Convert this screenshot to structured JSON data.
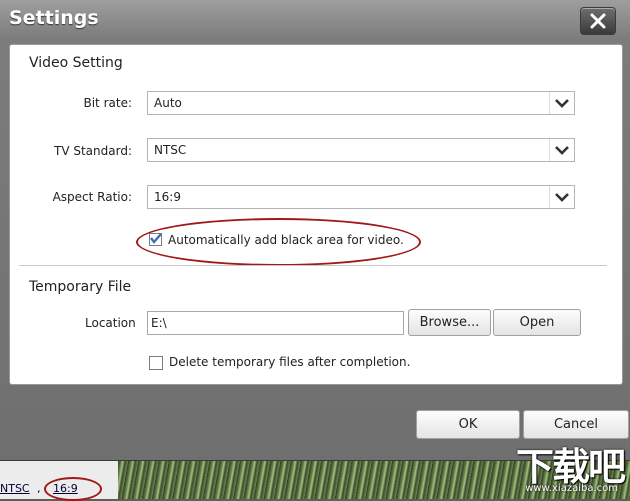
{
  "window": {
    "title": "Settings",
    "close_icon": "close-icon"
  },
  "video": {
    "section_title": "Video Setting",
    "bitrate": {
      "label": "Bit rate:",
      "value": "Auto"
    },
    "tv_standard": {
      "label": "TV Standard:",
      "value": "NTSC"
    },
    "aspect_ratio": {
      "label": "Aspect Ratio:",
      "value": "16:9"
    },
    "black_area": {
      "label": "Automatically add black area for video.",
      "checked": true
    }
  },
  "temp": {
    "section_title": "Temporary File",
    "location_label": "Location",
    "location_value": "E:\\",
    "browse_label": "Browse...",
    "open_label": "Open",
    "delete_label": "Delete temporary files after completion.",
    "delete_checked": false
  },
  "footer": {
    "ok_label": "OK",
    "cancel_label": "Cancel"
  },
  "background": {
    "status_standard": "NTSC",
    "status_separator": ",",
    "status_ratio": "16:9"
  },
  "watermark": {
    "text": "下载吧",
    "url": "www.xiazaiba.com"
  },
  "colors": {
    "highlight": "#a01818",
    "check": "#3d6fb6"
  }
}
